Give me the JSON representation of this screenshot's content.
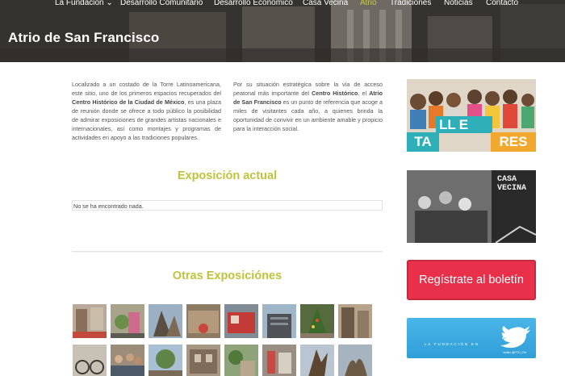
{
  "nav": {
    "items": [
      {
        "label": "La Fundación ⌄"
      },
      {
        "label": "Desarrollo Comunitario"
      },
      {
        "label": "Desarrollo Económico"
      },
      {
        "label": "Casa Vecina"
      },
      {
        "label": "Atrio"
      },
      {
        "label": "Tradiciones"
      },
      {
        "label": "Noticias"
      },
      {
        "label": "Contacto"
      }
    ],
    "active_color": "#c8cc3a"
  },
  "page": {
    "title": "Atrio de San Francisco"
  },
  "intro": {
    "left": {
      "p1": "Localizado a un costado de la Torre Latinoamericana, este sitio, uno de los primeros espacios recuperados del ",
      "b1": "Centro Histórico de la Ciudad de México",
      "p2": ", es una plaza de reunión donde se ofrece a todo público la posibilidad de admirar exposiciones de grandes artistas nacionales e internacionales, así como montajes y programas de actividades en apoyo a las tradiciones populares."
    },
    "right": {
      "p1": "Por su situación estratégica sobre la vía de acceso peatonal más importante del ",
      "b1": "Centro Histórico",
      "p2": ", el ",
      "b2": "Atrio de San Francisco",
      "p3": " es un punto de referencia que acoge a miles de visitantes cada año, a quienes brinda la oportunidad de convivir en un ambiente amable y propicio para la interacción social."
    }
  },
  "current": {
    "title": "Exposición actual",
    "empty_text": "No se ha encontrado nada."
  },
  "others": {
    "title": "Otras Exposiciónes"
  },
  "sidebar": {
    "talleres": {
      "row1": [
        "LL",
        "E"
      ],
      "row2": [
        "TA",
        "RES"
      ]
    },
    "casa_vecina": {
      "line1": "CASA",
      "line2": "VECINA"
    },
    "boletin_label": "Regístrate al boletín",
    "twitter_label": "LA FUNDACIÓN EN",
    "twitter_handle": "twitter @FCH_CM"
  },
  "colors": {
    "accent": "#bfc33b",
    "boletin": "#e8304a",
    "twitter": "#3aa9df"
  }
}
